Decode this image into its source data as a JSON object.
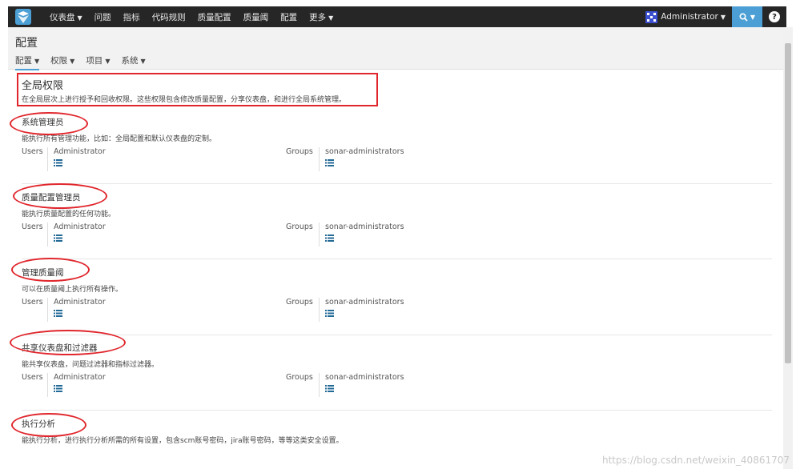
{
  "topnav": {
    "items": [
      {
        "label": "仪表盘",
        "has_caret": true
      },
      {
        "label": "问题",
        "has_caret": false
      },
      {
        "label": "指标",
        "has_caret": false
      },
      {
        "label": "代码规则",
        "has_caret": false
      },
      {
        "label": "质量配置",
        "has_caret": false
      },
      {
        "label": "质量阈",
        "has_caret": false
      },
      {
        "label": "配置",
        "has_caret": false
      },
      {
        "label": "更多",
        "has_caret": true
      }
    ],
    "user": "Administrator",
    "search_icon": "search-icon",
    "help_label": "?"
  },
  "header": {
    "title": "配置",
    "tabs": [
      "配置",
      "权限",
      "项目",
      "系统"
    ]
  },
  "intro": {
    "title": "全局权限",
    "desc": "在全局层次上进行授予和回收权限。这些权限包含修改质量配置，分享仪表盘，和进行全局系统管理。"
  },
  "sections": [
    {
      "title": "系统管理员",
      "desc": "能执行所有管理功能，比如：全局配置和默认仪表盘的定制。",
      "users_label": "Users",
      "user": "Administrator",
      "groups_label": "Groups",
      "group": "sonar-administrators"
    },
    {
      "title": "质量配置管理员",
      "desc": "能执行质量配置的任何功能。",
      "users_label": "Users",
      "user": "Administrator",
      "groups_label": "Groups",
      "group": "sonar-administrators"
    },
    {
      "title": "管理质量阈",
      "desc": "可以在质量阈上执行所有操作。",
      "users_label": "Users",
      "user": "Administrator",
      "groups_label": "Groups",
      "group": "sonar-administrators"
    },
    {
      "title": "共享仪表盘和过滤器",
      "desc": "能共享仪表盘，问题过滤器和指标过滤器。",
      "users_label": "Users",
      "user": "Administrator",
      "groups_label": "Groups",
      "group": "sonar-administrators"
    },
    {
      "title": "执行分析",
      "desc": "能执行分析，进行执行分析所需的所有设置，包含scm账号密码，jira账号密码，等等这类安全设置。"
    }
  ],
  "watermark": "https://blog.csdn.net/weixin_40861707",
  "colors": {
    "nav_bg": "#262626",
    "accent": "#4b9fd5",
    "annotation": "#e0262c"
  }
}
